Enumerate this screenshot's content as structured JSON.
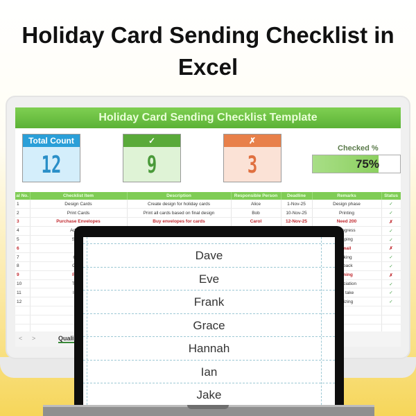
{
  "headline": {
    "line1": "Holiday Card Sending Checklist in",
    "line2": "Excel"
  },
  "sheet": {
    "title": "Holiday Card Sending Checklist Template",
    "cards": [
      {
        "label": "Total Count",
        "value": "12",
        "header_color": "#2a9fd8",
        "body_color": "#d4eefb",
        "text_color": "#2a8fc8"
      },
      {
        "label": "✓",
        "value": "9",
        "header_color": "#5aaa3a",
        "body_color": "#dff3d6",
        "text_color": "#4a9a3a"
      },
      {
        "label": "✗",
        "value": "3",
        "header_color": "#e8804a",
        "body_color": "#fbe2d6",
        "text_color": "#e07040"
      }
    ],
    "checked_label": "Checked %",
    "checked_value": "75%",
    "checked_fraction": 0.75,
    "columns": [
      "al No.",
      "Checklist Item",
      "Description",
      "Responsible Person",
      "Deadline",
      "Remarks",
      "Status"
    ],
    "rows": [
      {
        "no": "1",
        "item": "Design Cards",
        "desc": "Create design for holiday cards",
        "person": "Alice",
        "deadline": "1-Nov-25",
        "remarks": "Design phase",
        "status": "✓",
        "flag": false
      },
      {
        "no": "2",
        "item": "Print Cards",
        "desc": "Print all cards based on final design",
        "person": "Bob",
        "deadline": "10-Nov-25",
        "remarks": "Printing",
        "status": "✓",
        "flag": false
      },
      {
        "no": "3",
        "item": "Purchase Envelopes",
        "desc": "Buy envelopes for cards",
        "person": "Carol",
        "deadline": "12-Nov-25",
        "remarks": "Need 200",
        "status": "✗",
        "flag": true
      },
      {
        "no": "4",
        "item": "Address",
        "desc": "",
        "person": "",
        "deadline": "",
        "remarks": "progress",
        "status": "✓",
        "flag": false
      },
      {
        "no": "5",
        "item": "Stamp",
        "desc": "",
        "person": "",
        "deadline": "",
        "remarks": "mping",
        "status": "✓",
        "flag": false
      },
      {
        "no": "6",
        "item": "Ma",
        "desc": "",
        "person": "",
        "deadline": "",
        "remarks": "mail",
        "status": "✗",
        "flag": true
      },
      {
        "no": "7",
        "item": "Confi",
        "desc": "",
        "person": "",
        "deadline": "",
        "remarks": "cking",
        "status": "✓",
        "flag": false
      },
      {
        "no": "8",
        "item": "Gathe",
        "desc": "",
        "person": "",
        "deadline": "",
        "remarks": "dback",
        "status": "✓",
        "flag": false
      },
      {
        "no": "9",
        "item": "Plan f",
        "desc": "",
        "person": "",
        "deadline": "",
        "remarks": "nning",
        "status": "✗",
        "flag": true
      },
      {
        "no": "10",
        "item": "Thank",
        "desc": "",
        "person": "",
        "deadline": "",
        "remarks": "preciation",
        "status": "✓",
        "flag": false
      },
      {
        "no": "11",
        "item": "Inven",
        "desc": "",
        "person": "",
        "deadline": "",
        "remarks": "ck take",
        "status": "✓",
        "flag": false
      },
      {
        "no": "12",
        "item": "Revi",
        "desc": "",
        "person": "",
        "deadline": "",
        "remarks": "alizing",
        "status": "✓",
        "flag": false
      }
    ],
    "sheet_tab": "Quali"
  },
  "front_list": [
    "Dave",
    "Eve",
    "Frank",
    "Grace",
    "Hannah",
    "Ian",
    "Jake"
  ]
}
